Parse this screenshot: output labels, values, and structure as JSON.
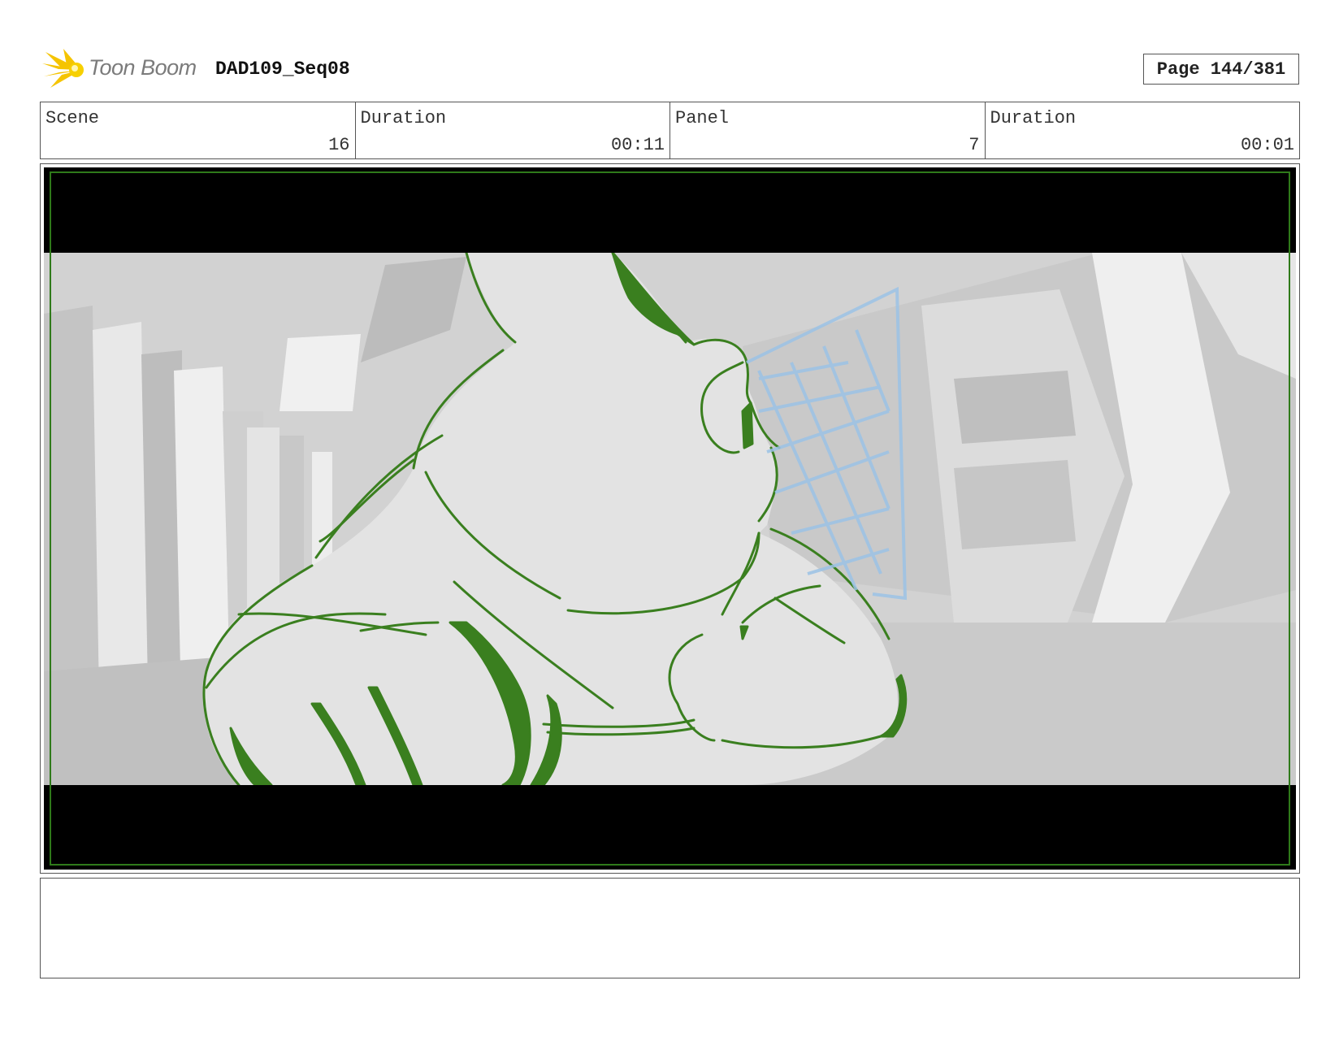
{
  "header": {
    "logo_text": "Toon Boom",
    "sequence_title": "DAD109_Seq08",
    "page_label": "Page 144/381"
  },
  "info": {
    "scene_label": "Scene",
    "scene_value": "16",
    "scene_duration_label": "Duration",
    "scene_duration_value": "00:11",
    "panel_label": "Panel",
    "panel_value": "7",
    "panel_duration_label": "Duration",
    "panel_duration_value": "00:01"
  },
  "panel_image": {
    "content": "storyboard-sketch",
    "colors": {
      "sketch_line": "#3a7f1f",
      "guide_blue": "#9cc3e6",
      "letterbox": "#000000",
      "background_grey": "#d0d0d0",
      "safe_area": "#2f7a1a"
    }
  },
  "notes": {
    "text": ""
  }
}
